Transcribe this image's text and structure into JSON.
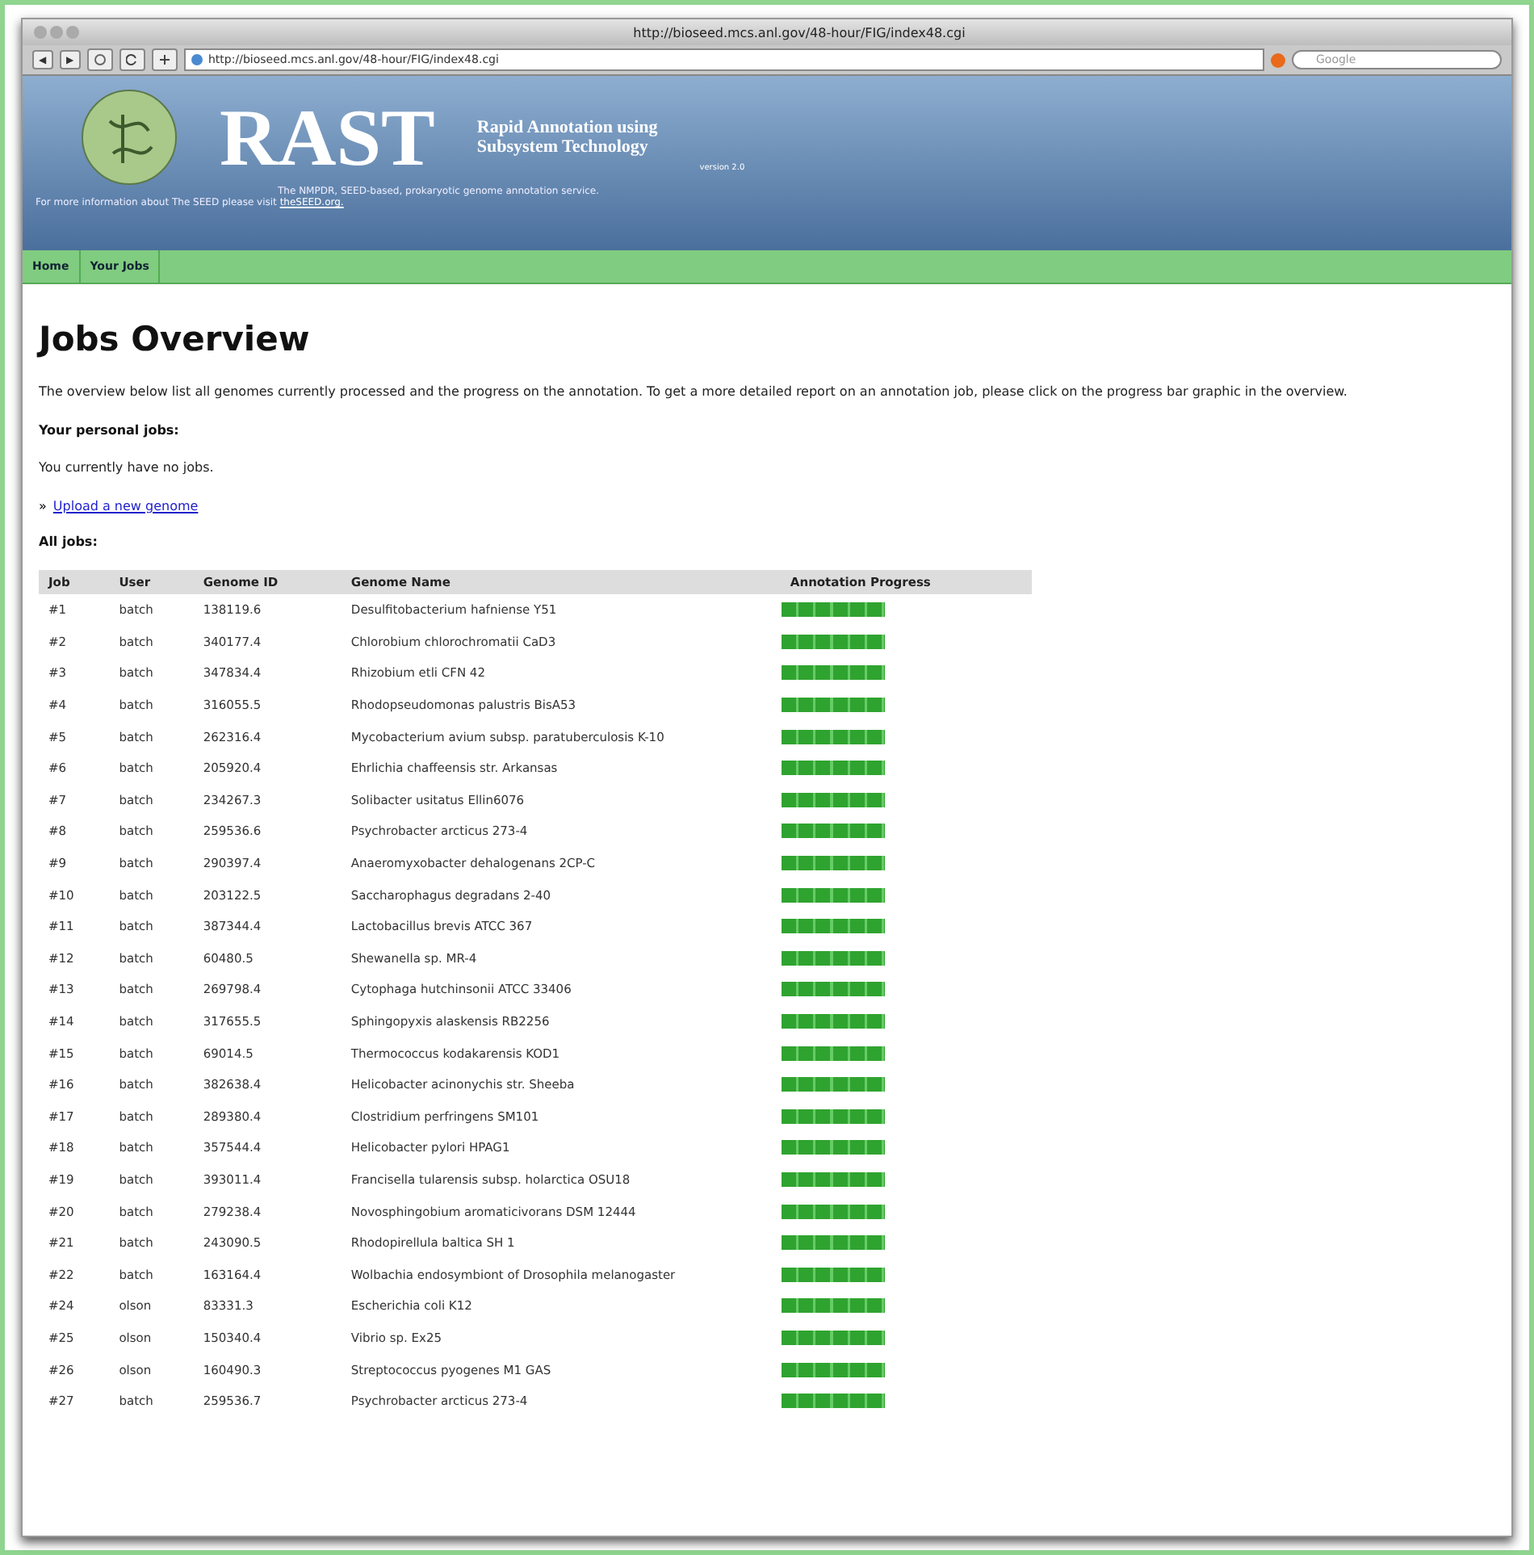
{
  "window": {
    "title": "http://bioseed.mcs.anl.gov/48-hour/FIG/index48.cgi"
  },
  "toolbar": {
    "buttons": [
      "◀",
      "▶"
    ],
    "address": "http://bioseed.mcs.anl.gov/48-hour/FIG/index48.cgi",
    "search": {
      "placeholder": "Google"
    }
  },
  "header": {
    "logo": "RAST",
    "subtitle_line_1": "Rapid Annotation using",
    "subtitle_line_2": "Subsystem Technology",
    "version": "version 2.0",
    "tagline": "The NMPDR, SEED-based, prokaryotic genome annotation service.",
    "info": "For more information about The SEED please visit ",
    "info_link": "theSEED.org."
  },
  "nav": [
    {
      "label": "Home"
    },
    {
      "label": "Your Jobs"
    }
  ],
  "page": {
    "title": "Jobs Overview",
    "intro": "The overview below list all genomes currently processed and the progress on the annotation. To get a more detailed report on an annotation job, please click on the progress bar graphic in the overview.",
    "personal_heading": "Your personal jobs:",
    "personal_text": "You currently have no jobs.",
    "bullet": "»",
    "upload_link": "Upload a new genome",
    "all_heading": "All jobs:"
  },
  "table": {
    "columns": [
      "Job",
      "User",
      "Genome ID",
      "Genome Name",
      "Annotation Progress"
    ],
    "rows": [
      {
        "job": "#1",
        "user": "batch",
        "id": "138119.6",
        "name": "Desulfitobacterium hafniense Y51",
        "level": 1
      },
      {
        "job": "#2",
        "user": "batch",
        "id": "340177.4",
        "name": "Chlorobium chlorochromatii CaD3",
        "level": 1
      },
      {
        "job": "#3",
        "user": "batch",
        "id": "347834.4",
        "name": "Rhizobium etli CFN 42",
        "level": 1
      },
      {
        "job": "#4",
        "user": "batch",
        "id": "316055.5",
        "name": "Rhodopseudomonas palustris BisA53",
        "level": 1
      },
      {
        "job": "#5",
        "user": "batch",
        "id": "262316.4",
        "name": "Mycobacterium avium subsp. paratuberculosis K-10",
        "level": 1
      },
      {
        "job": "#6",
        "user": "batch",
        "id": "205920.4",
        "name": "Ehrlichia chaffeensis str. Arkansas",
        "level": 1
      },
      {
        "job": "#7",
        "user": "batch",
        "id": "234267.3",
        "name": "Solibacter usitatus Ellin6076",
        "level": 1
      },
      {
        "job": "#8",
        "user": "batch",
        "id": "259536.6",
        "name": "Psychrobacter arcticus 273-4",
        "level": 1
      },
      {
        "job": "#9",
        "user": "batch",
        "id": "290397.4",
        "name": "Anaeromyxobacter dehalogenans 2CP-C",
        "level": 1
      },
      {
        "job": "#10",
        "user": "batch",
        "id": "203122.5",
        "name": "Saccharophagus degradans 2-40",
        "level": 1
      },
      {
        "job": "#11",
        "user": "batch",
        "id": "387344.4",
        "name": "Lactobacillus brevis ATCC 367",
        "level": 1
      },
      {
        "job": "#12",
        "user": "batch",
        "id": "60480.5",
        "name": "Shewanella sp. MR-4",
        "level": 1
      },
      {
        "job": "#13",
        "user": "batch",
        "id": "269798.4",
        "name": "Cytophaga hutchinsonii ATCC 33406",
        "level": 1
      },
      {
        "job": "#14",
        "user": "batch",
        "id": "317655.5",
        "name": "Sphingopyxis alaskensis RB2256",
        "level": 1
      },
      {
        "job": "#15",
        "user": "batch",
        "id": "69014.5",
        "name": "Thermococcus kodakarensis KOD1",
        "level": 1
      },
      {
        "job": "#16",
        "user": "batch",
        "id": "382638.4",
        "name": "Helicobacter acinonychis str. Sheeba",
        "level": 1
      },
      {
        "job": "#17",
        "user": "batch",
        "id": "289380.4",
        "name": "Clostridium perfringens SM101",
        "level": 1
      },
      {
        "job": "#18",
        "user": "batch",
        "id": "357544.4",
        "name": "Helicobacter pylori HPAG1",
        "level": 1
      },
      {
        "job": "#19",
        "user": "batch",
        "id": "393011.4",
        "name": "Francisella tularensis subsp. holarctica OSU18",
        "level": 1
      },
      {
        "job": "#20",
        "user": "batch",
        "id": "279238.4",
        "name": "Novosphingobium aromaticivorans DSM 12444",
        "level": 1
      },
      {
        "job": "#21",
        "user": "batch",
        "id": "243090.5",
        "name": "Rhodopirellula baltica SH 1",
        "level": 1
      },
      {
        "job": "#22",
        "user": "batch",
        "id": "163164.4",
        "name": "Wolbachia endosymbiont of Drosophila melanogaster",
        "level": 1
      },
      {
        "job": "#24",
        "user": "olson",
        "id": "83331.3",
        "name": "Escherichia coli K12",
        "level": 1
      },
      {
        "job": "#25",
        "user": "olson",
        "id": "150340.4",
        "name": "Vibrio sp. Ex25",
        "level": 1
      },
      {
        "job": "#26",
        "user": "olson",
        "id": "160490.3",
        "name": "Streptococcus pyogenes M1 GAS",
        "level": 1
      },
      {
        "job": "#27",
        "user": "batch",
        "id": "259536.7",
        "name": "Psychrobacter arcticus 273-4",
        "level": 1
      }
    ]
  }
}
